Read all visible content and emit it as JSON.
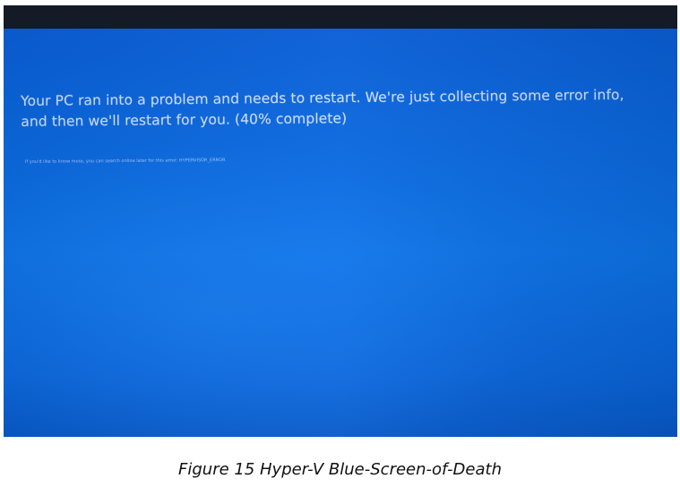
{
  "screen": {
    "message": "Your PC ran into a problem and needs to restart. We're just collecting some error info, and then we'll restart for you. (40% complete)",
    "info": "If you'd like to know more, you can search online later for this error: HYPERVISOR_ERROR",
    "progress_percent": 40,
    "background_color": "#0b67dd",
    "text_color": "#c9dcff"
  },
  "caption": "Figure 15 Hyper-V Blue-Screen-of-Death"
}
